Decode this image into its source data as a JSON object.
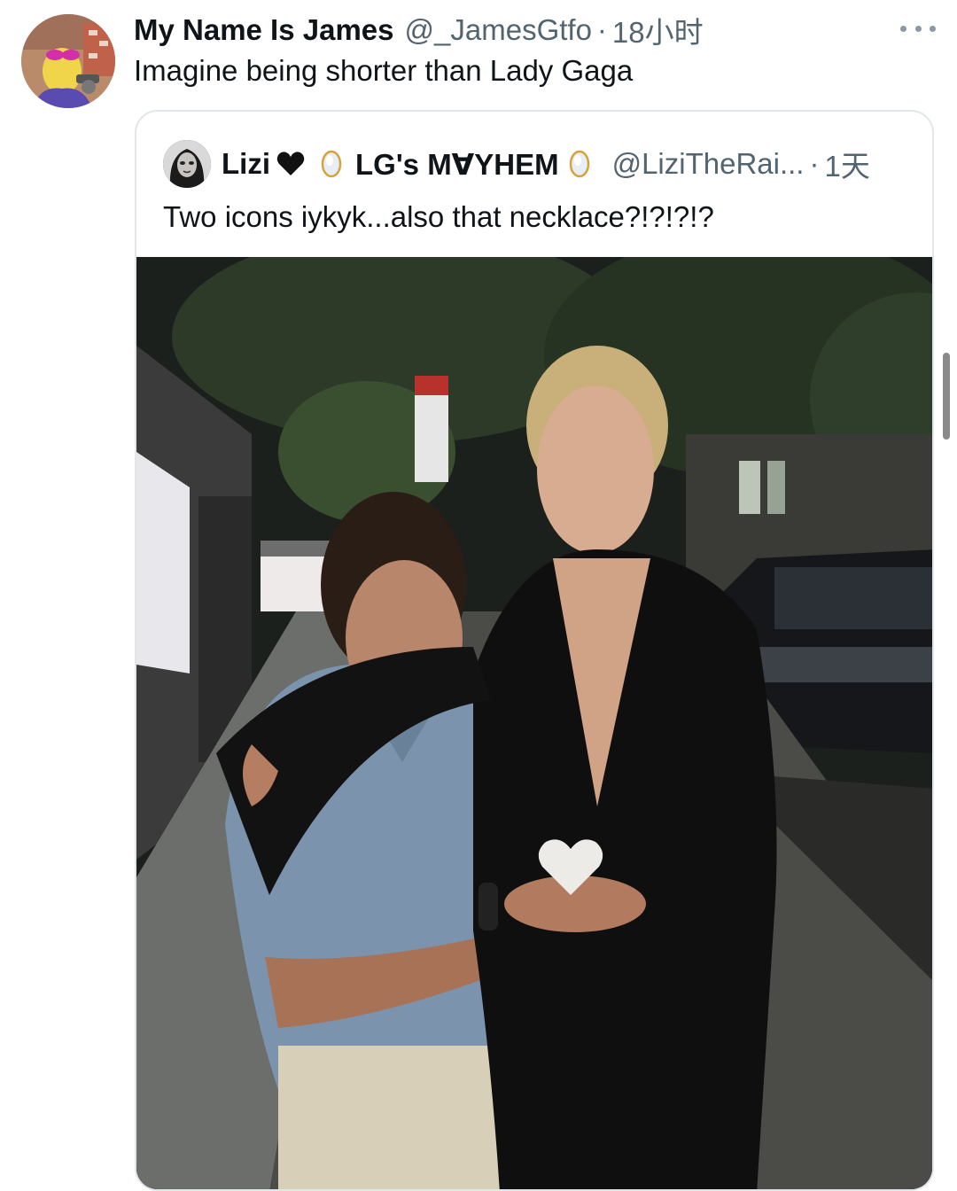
{
  "tweet": {
    "display_name": "My Name Is James",
    "handle": "@_JamesGtfo",
    "separator": "·",
    "time": "18小时",
    "text": "Imagine being shorter than Lady Gaga",
    "avatar_icon": "user-avatar",
    "more_icon": "more-horizontal-icon"
  },
  "quote": {
    "display_name": "Lizi",
    "heart_emoji": "black-heart-emoji",
    "egg_emoji": "moonstone-emoji",
    "display_name_2": "LG's M∀YHEM",
    "handle": "@LiziTheRai...",
    "separator": "·",
    "time": "1天",
    "text": "Two icons iykyk...also that necklace?!?!?!?",
    "photo_subject": "photo"
  },
  "colors": {
    "text": "#0f1419",
    "secondary": "#536471",
    "border": "#e1e6ea"
  }
}
